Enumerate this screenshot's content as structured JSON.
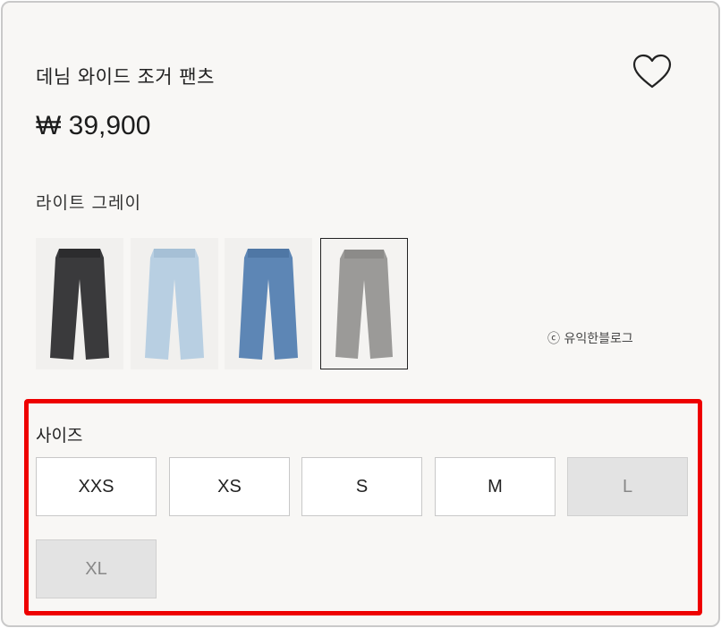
{
  "product": {
    "title": "데님 와이드 조거 팬츠",
    "price": "₩ 39,900",
    "wishlist_icon": "heart-outline-icon"
  },
  "color": {
    "selected_label": "라이트 그레이",
    "swatches": [
      {
        "name": "black",
        "color": "#3a3a3c"
      },
      {
        "name": "light-blue",
        "color": "#b8cfe2"
      },
      {
        "name": "mid-blue",
        "color": "#5d86b5"
      },
      {
        "name": "light-gray",
        "color": "#9b9a98",
        "selected": true
      }
    ]
  },
  "watermark": "ⓒ 유익한블로그",
  "size": {
    "label": "사이즈",
    "options": [
      {
        "label": "XXS",
        "available": true
      },
      {
        "label": "XS",
        "available": true
      },
      {
        "label": "S",
        "available": true
      },
      {
        "label": "M",
        "available": true
      },
      {
        "label": "L",
        "available": false
      },
      {
        "label": "XL",
        "available": false
      }
    ]
  },
  "highlight_color": "#ee0000"
}
